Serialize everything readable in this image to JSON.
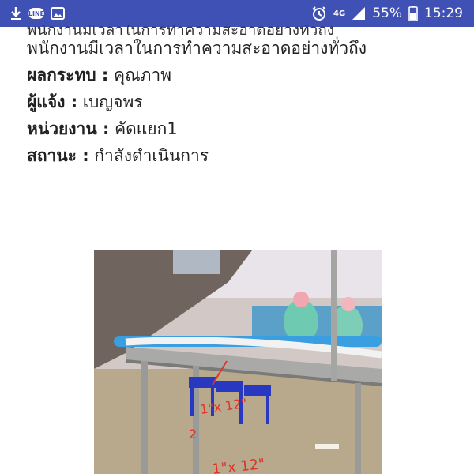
{
  "status_bar": {
    "time": "15:29",
    "battery": "55%",
    "network": "4G",
    "left_icons": [
      "line-app-icon",
      "image-icon"
    ],
    "right_icons": [
      "alarm-icon",
      "signal-icon",
      "battery-icon"
    ]
  },
  "report": {
    "top_cut_text": "พนักงานมีเวลาในการทำความสะอาดอย่างทั่วถึง",
    "description_tail": "พนักงานมีเวลาในการทำความสะอาดอย่างทั่วถึง",
    "impact": {
      "label": "ผลกระทบ :",
      "value": " คุณภาพ"
    },
    "reporter": {
      "label": "ผู้แจ้ง :",
      "value": " เบญจพร"
    },
    "department": {
      "label": "หน่วยงาน :",
      "value": " คัดแยก1"
    },
    "status": {
      "label": "สถานะ :",
      "value": " กำลังดำเนินการ"
    }
  },
  "photo": {
    "handwriting": [
      "1\"x 12\"",
      "2",
      "1\"x 12\""
    ]
  }
}
